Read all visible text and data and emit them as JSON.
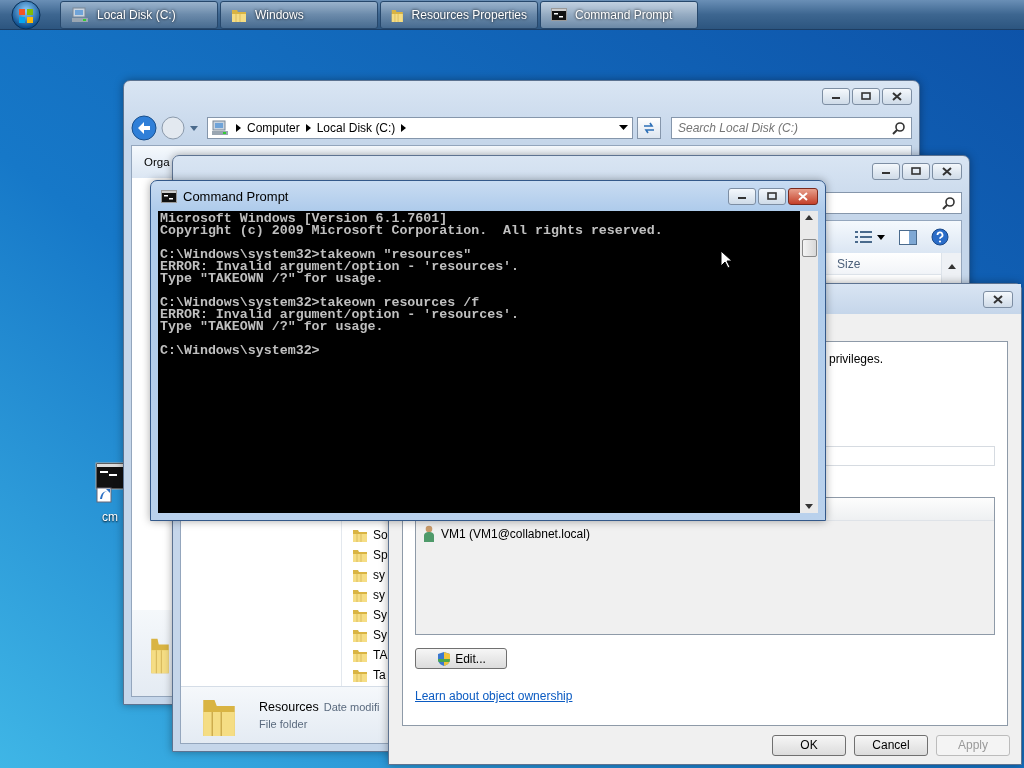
{
  "taskbar": {
    "items": [
      {
        "label": "Local Disk (C:)",
        "kind": "drive",
        "selected": false
      },
      {
        "label": "Windows",
        "kind": "folder",
        "selected": false
      },
      {
        "label": "Resources Properties",
        "kind": "folder",
        "selected": false
      },
      {
        "label": "Command Prompt",
        "kind": "console",
        "selected": true
      }
    ]
  },
  "desktop_icons": [
    {
      "label": "cm"
    }
  ],
  "explorer_back": {
    "breadcrumb": [
      "Computer",
      "Local Disk (C:)"
    ],
    "search": {
      "placeholder": "Search Local Disk (C:)"
    },
    "toolbar": [
      "Orga"
    ]
  },
  "explorer_front": {
    "columns": [
      "Size"
    ],
    "files": [
      {
        "name": "So"
      },
      {
        "name": "Sp"
      },
      {
        "name": "sy"
      },
      {
        "name": "sy"
      },
      {
        "name": "Sy"
      },
      {
        "name": "Sy"
      },
      {
        "name": "TA"
      },
      {
        "name": "Ta"
      }
    ],
    "details": {
      "name": "Resources",
      "field": "Date modifi",
      "type": "File folder"
    }
  },
  "properties_dialog": {
    "text": "privileges.",
    "owners": [
      {
        "name": "VM1 (VM1@collabnet.local)"
      }
    ],
    "edit_button": "Edit...",
    "link": "Learn about object ownership",
    "buttons": [
      {
        "label": "OK",
        "disabled": false
      },
      {
        "label": "Cancel",
        "disabled": false
      },
      {
        "label": "Apply",
        "disabled": true
      }
    ]
  },
  "command_prompt": {
    "title": "Command Prompt",
    "blocks": [
      [
        "Microsoft Windows [Version 6.1.7601]",
        "Copyright (c) 2009 Microsoft Corporation.  All rights reserved."
      ],
      [
        "C:\\Windows\\system32>takeown \"resources\"",
        "ERROR: Invalid argument/option - 'resources'.",
        "Type \"TAKEOWN /?\" for usage."
      ],
      [
        "C:\\Windows\\system32>takeown resources /f",
        "ERROR: Invalid argument/option - 'resources'.",
        "Type \"TAKEOWN /?\" for usage."
      ],
      [
        "C:\\Windows\\system32>"
      ]
    ]
  }
}
